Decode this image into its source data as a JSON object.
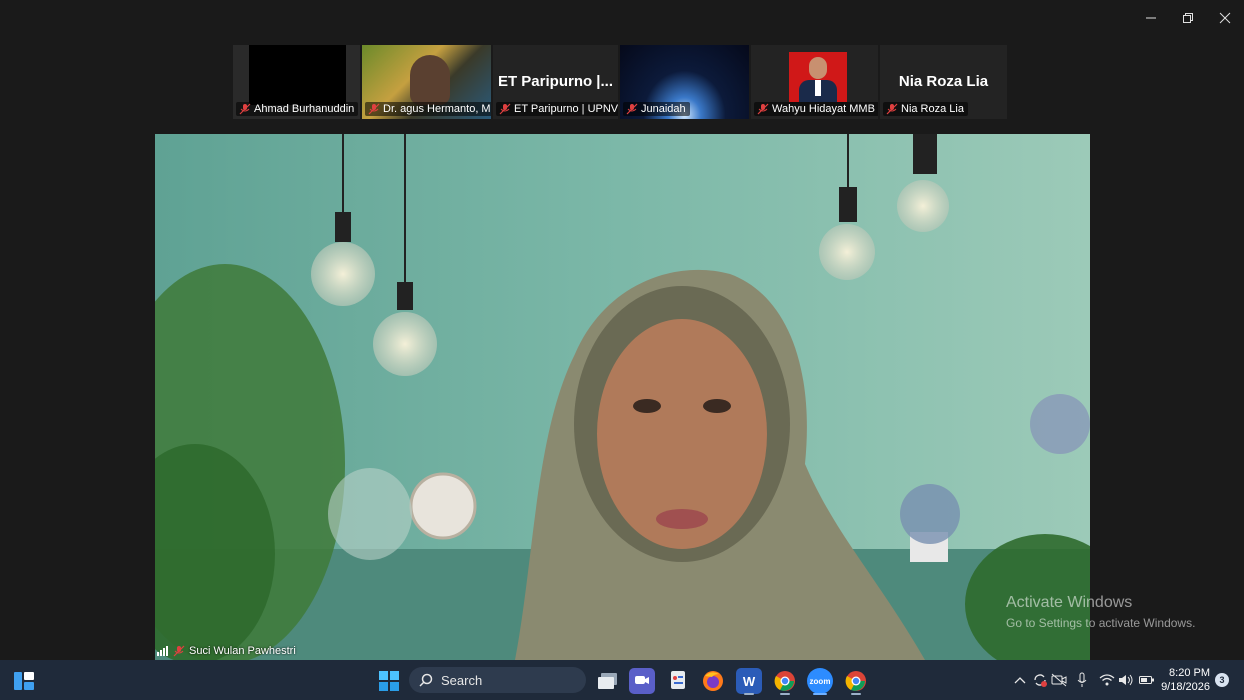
{
  "participants": [
    {
      "name": "Ahmad Burhanuddin",
      "display": ""
    },
    {
      "name": "Dr. agus Hermanto, MHI",
      "display": ""
    },
    {
      "name": "ET Paripurno | UPNVY",
      "display": "ET Paripurno |..."
    },
    {
      "name": "Junaidah",
      "display": ""
    },
    {
      "name": "Wahyu Hidayat MMB",
      "display": ""
    },
    {
      "name": "Nia Roza Lia",
      "display": "Nia Roza Lia"
    }
  ],
  "speaker": {
    "name": "Suci Wulan Pawhestri"
  },
  "watermark": {
    "line1": "Activate Windows",
    "line2": "Go to Settings to activate Windows."
  },
  "taskbar": {
    "search_label": "Search",
    "zoom_label": "zoom",
    "time": "8:20 PM",
    "date": "9/18/2026",
    "notifications": "3"
  },
  "colors": {
    "taskbar": "#1f2a3a",
    "background": "#1a1a1a",
    "main_bg": "#7fb4a4"
  }
}
